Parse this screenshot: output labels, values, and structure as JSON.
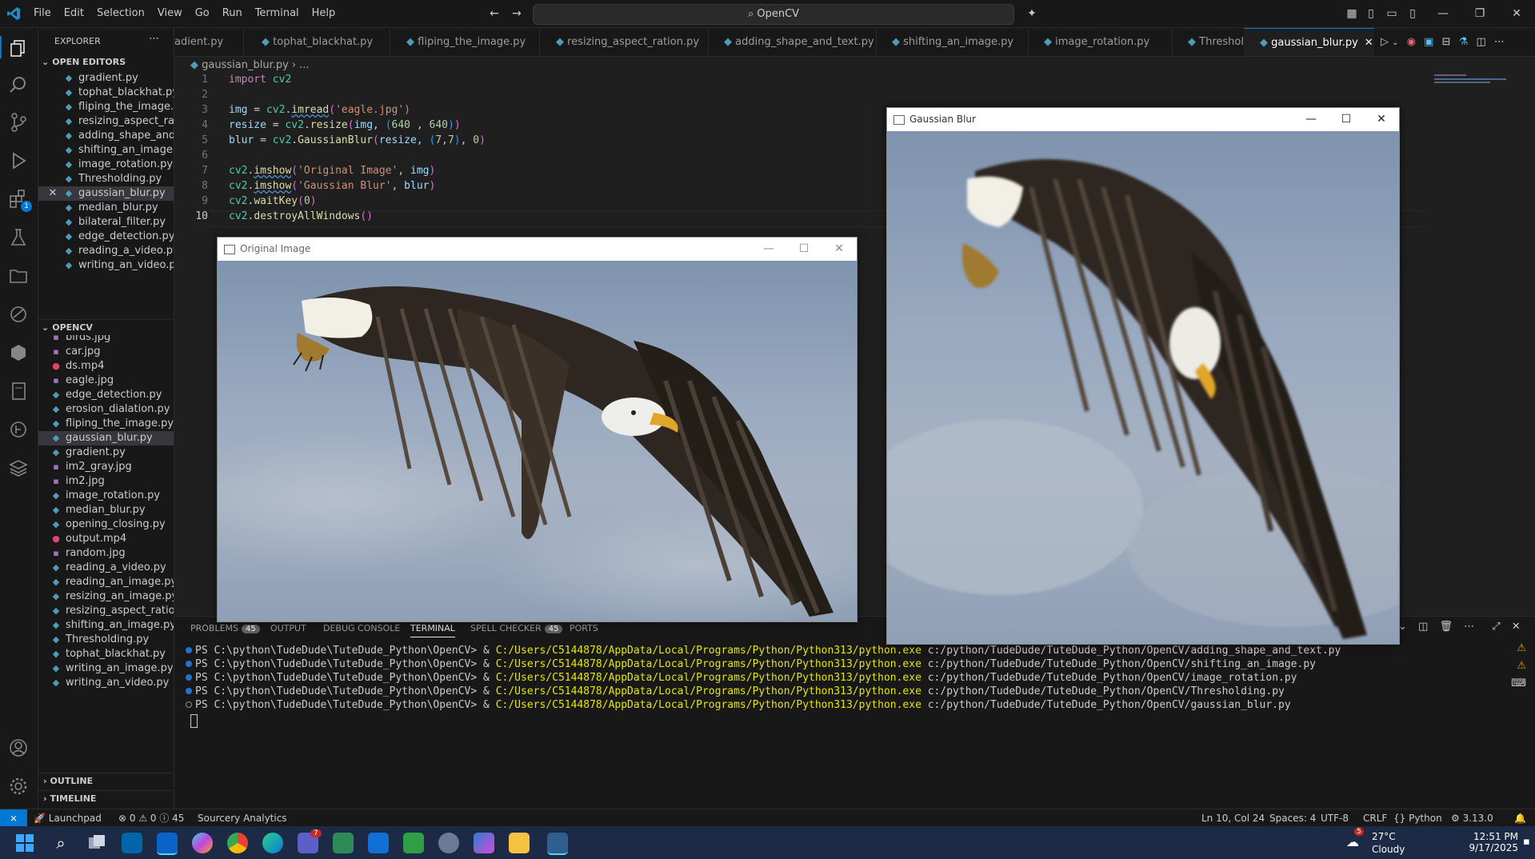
{
  "menu": [
    "File",
    "Edit",
    "Selection",
    "View",
    "Go",
    "Run",
    "Terminal",
    "Help"
  ],
  "command_center": "OpenCV",
  "sidebar": {
    "title": "EXPLORER",
    "open_editors_label": "OPEN EDITORS",
    "open_editors": [
      "gradient.py",
      "tophat_blackhat.py",
      "fliping_the_image.py",
      "resizing_aspect_ration.py",
      "adding_shape_and_text.py",
      "shifting_an_image.py",
      "image_rotation.py",
      "Thresholding.py",
      "gaussian_blur.py",
      "median_blur.py",
      "bilateral_filter.py",
      "edge_detection.py",
      "reading_a_video.py",
      "writing_an_video.py"
    ],
    "folder_label": "OPENCV",
    "files": [
      "birds.jpg",
      "car.jpg",
      "ds.mp4",
      "eagle.jpg",
      "edge_detection.py",
      "erosion_dialation.py",
      "fliping_the_image.py",
      "gaussian_blur.py",
      "gradient.py",
      "im2_gray.jpg",
      "im2.jpg",
      "image_rotation.py",
      "median_blur.py",
      "opening_closing.py",
      "output.mp4",
      "random.jpg",
      "reading_a_video.py",
      "reading_an_image.py",
      "resizing_an_image.py",
      "resizing_aspect_ration.py",
      "shifting_an_image.py",
      "Thresholding.py",
      "tophat_blackhat.py",
      "writing_an_image.py",
      "writing_an_video.py"
    ],
    "outline_label": "OUTLINE",
    "timeline_label": "TIMELINE",
    "extensions_badge": "1"
  },
  "tabs": [
    "adient.py",
    "tophat_blackhat.py",
    "fliping_the_image.py",
    "resizing_aspect_ration.py",
    "adding_shape_and_text.py",
    "shifting_an_image.py",
    "image_rotation.py",
    "Thresholding.py",
    "gaussian_blur.py"
  ],
  "editor": {
    "breadcrumb_file": "gaussian_blur.py",
    "breadcrumb_rest": "...",
    "line_numbers": [
      "1",
      "2",
      "3",
      "4",
      "5",
      "6",
      "7",
      "8",
      "9",
      "10"
    ]
  },
  "code": {
    "l1_kw": "import",
    "l1_mod": " cv2",
    "l3_var": "img",
    "l3_eq": " = ",
    "l3_mod": "cv2",
    "l3_dot": ".",
    "l3_fn": "imread",
    "l3_p1": "(",
    "l3_str": "'eagle.jpg'",
    "l3_p2": ")",
    "l4_var": "resize",
    "l4_eq": " = ",
    "l4_mod": "cv2",
    "l4_dot": ".",
    "l4_fn": "resize",
    "l4_p1": "(",
    "l4_a": "img, ",
    "l4_t1": "(",
    "l4_n1": "640",
    "l4_c": " , ",
    "l4_n2": "640",
    "l4_t2": ")",
    "l4_p2": ")",
    "l5_var": "blur",
    "l5_eq": " = ",
    "l5_mod": "cv2",
    "l5_dot": ".",
    "l5_fn": "GaussianBlur",
    "l5_p1": "(",
    "l5_a": "resize, ",
    "l5_t1": "(",
    "l5_n1": "7",
    "l5_c": ",",
    "l5_n2": "7",
    "l5_t2": ")",
    "l5_c2": ", ",
    "l5_n3": "0",
    "l5_p2": ")",
    "l7_mod": "cv2",
    "l7_dot": ".",
    "l7_fn": "imshow",
    "l7_p1": "(",
    "l7_str": "'Original Image'",
    "l7_c": ", ",
    "l7_a": "img",
    "l7_p2": ")",
    "l8_mod": "cv2",
    "l8_dot": ".",
    "l8_fn": "imshow",
    "l8_p1": "(",
    "l8_str": "'Gaussian Blur'",
    "l8_c": ", ",
    "l8_a": "blur",
    "l8_p2": ")",
    "l9_mod": "cv2",
    "l9_dot": ".",
    "l9_fn": "waitKey",
    "l9_p1": "(",
    "l9_n": "0",
    "l9_p2": ")",
    "l10_mod": "cv2",
    "l10_dot": ".",
    "l10_fn": "destroyAllWindows",
    "l10_p": "()"
  },
  "windows": {
    "original_title": "Original Image",
    "blur_title": "Gaussian Blur"
  },
  "panel": {
    "tabs": [
      "PROBLEMS",
      "OUTPUT",
      "DEBUG CONSOLE",
      "TERMINAL",
      "SPELL CHECKER",
      "PORTS"
    ],
    "problems_badge": "45",
    "spell_badge": "45",
    "prompt": "PS C:\\python\\TudeDude\\TuteDude_Python\\OpenCV> & ",
    "exe": "C:/Users/C5144878/AppData/Local/Programs/Python/Python313/python.exe",
    "scripts": [
      " c:/python/TudeDude/TuteDude_Python/OpenCV/adding_shape_and_text.py",
      " c:/python/TudeDude/TuteDude_Python/OpenCV/shifting_an_image.py",
      " c:/python/TudeDude/TuteDude_Python/OpenCV/image_rotation.py",
      " c:/python/TudeDude/TuteDude_Python/OpenCV/Thresholding.py",
      " c:/python/TudeDude/TuteDude_Python/OpenCV/gaussian_blur.py"
    ]
  },
  "status": {
    "launchpad": "Launchpad",
    "problems": "0 ⚠ 0 ⓘ 45",
    "sourcery": "Sourcery Analytics",
    "position": "Ln 10, Col 24",
    "spaces": "Spaces: 4",
    "encoding": "UTF-8",
    "eol": "CRLF",
    "language": "Python",
    "version": "3.13.0"
  },
  "taskbar": {
    "weather_temp": "27°C",
    "weather_desc": "Cloudy",
    "weather_badge": "5",
    "time": "12:51 PM",
    "date": "9/17/2025",
    "teams_badge": "7"
  },
  "colors": {
    "accent": "#0078d4",
    "terminal_exe": "#e5e510",
    "keyword": "#c586c0",
    "string": "#ce9178"
  }
}
